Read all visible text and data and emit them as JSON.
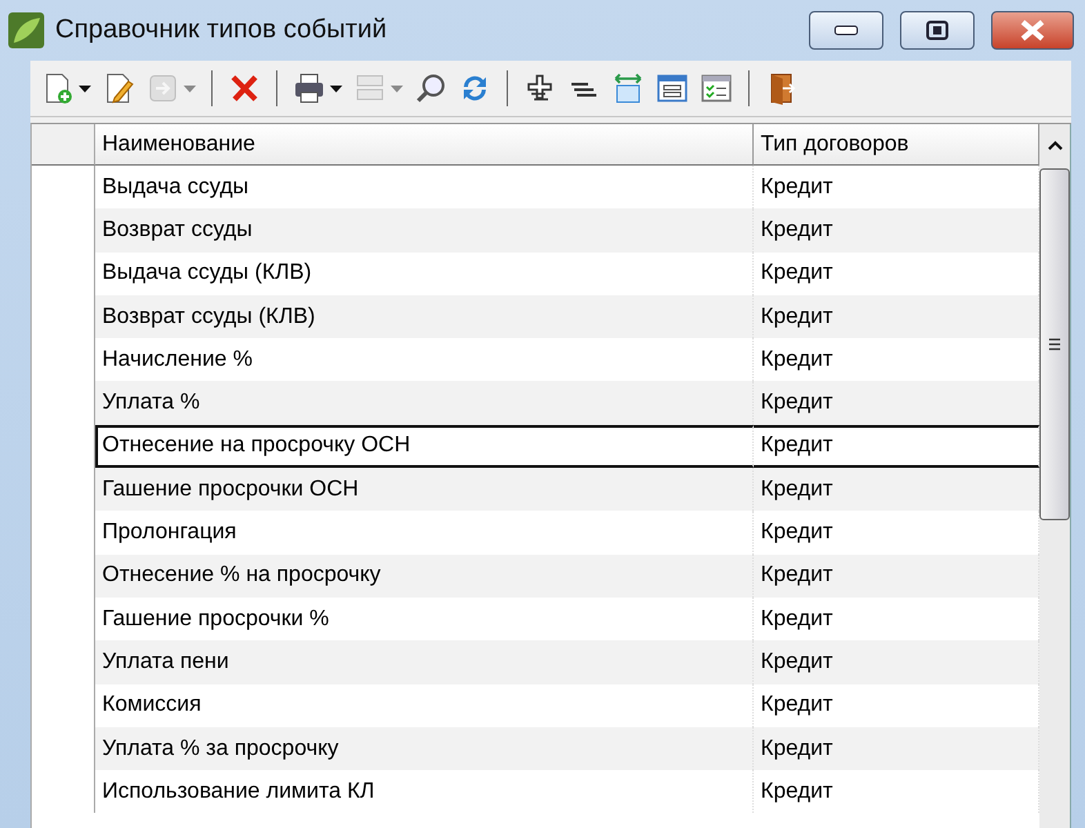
{
  "window": {
    "title": "Справочник типов событий"
  },
  "toolbar": [
    {
      "kind": "new",
      "dropdown": true,
      "disabled": false
    },
    {
      "kind": "edit",
      "disabled": false
    },
    {
      "kind": "forward",
      "dropdown": true,
      "disabled": true
    },
    {
      "kind": "separator"
    },
    {
      "kind": "delete",
      "disabled": false
    },
    {
      "kind": "separator"
    },
    {
      "kind": "print",
      "dropdown": true,
      "disabled": false
    },
    {
      "kind": "list",
      "dropdown": true,
      "disabled": true
    },
    {
      "kind": "search",
      "disabled": false
    },
    {
      "kind": "refresh",
      "disabled": false
    },
    {
      "kind": "separator"
    },
    {
      "kind": "expand",
      "disabled": false
    },
    {
      "kind": "collapse",
      "disabled": false
    },
    {
      "kind": "fit",
      "disabled": false
    },
    {
      "kind": "form",
      "disabled": false
    },
    {
      "kind": "checklist",
      "disabled": false
    },
    {
      "kind": "separator"
    },
    {
      "kind": "exit",
      "disabled": false
    }
  ],
  "table": {
    "columns": [
      "Наименование",
      "Тип договоров"
    ],
    "rows": [
      {
        "name": "Выдача ссуды",
        "type": "Кредит",
        "selected": false
      },
      {
        "name": "Возврат ссуды",
        "type": "Кредит",
        "selected": false
      },
      {
        "name": "Выдача ссуды (КЛВ)",
        "type": "Кредит",
        "selected": false
      },
      {
        "name": "Возврат ссуды (КЛВ)",
        "type": "Кредит",
        "selected": false
      },
      {
        "name": "Начисление %",
        "type": "Кредит",
        "selected": false
      },
      {
        "name": "Уплата %",
        "type": "Кредит",
        "selected": false
      },
      {
        "name": "Отнесение на просрочку ОСН",
        "type": "Кредит",
        "selected": true
      },
      {
        "name": "Гашение просрочки ОСН",
        "type": "Кредит",
        "selected": false
      },
      {
        "name": "Пролонгация",
        "type": "Кредит",
        "selected": false
      },
      {
        "name": "Отнесение % на просрочку",
        "type": "Кредит",
        "selected": false
      },
      {
        "name": "Гашение просрочки %",
        "type": "Кредит",
        "selected": false
      },
      {
        "name": "Уплата пени",
        "type": "Кредит",
        "selected": false
      },
      {
        "name": "Комиссия",
        "type": "Кредит",
        "selected": false
      },
      {
        "name": "Уплата % за просрочку",
        "type": "Кредит",
        "selected": false
      },
      {
        "name": "Использование лимита КЛ",
        "type": "Кредит",
        "selected": false
      }
    ]
  }
}
